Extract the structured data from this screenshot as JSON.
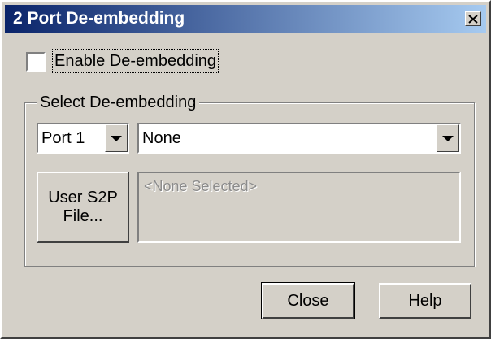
{
  "window": {
    "title": "2 Port De-embedding",
    "close_icon": "close-icon"
  },
  "enable": {
    "label": "Enable De-embedding",
    "checked": false
  },
  "group": {
    "label": "Select De-embedding"
  },
  "port_select": {
    "value": "Port 1"
  },
  "deembed_select": {
    "value": "None"
  },
  "file_button": {
    "line1": "User S2P",
    "line2": "File..."
  },
  "file_display": {
    "value": "<None Selected>"
  },
  "buttons": {
    "close": "Close",
    "help": "Help"
  }
}
